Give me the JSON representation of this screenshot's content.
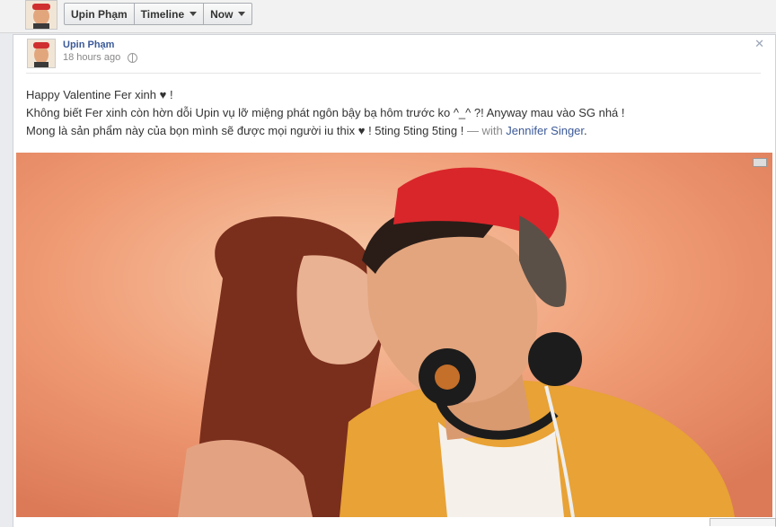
{
  "topbar": {
    "profile_label": "Upin Phạm",
    "timeline_label": "Timeline",
    "now_label": "Now"
  },
  "post": {
    "author": "Upin Phạm",
    "time": "18 hours ago",
    "message_line1": "Happy Valentine Fer xinh ♥ !",
    "message_line2": "Không biết Fer xinh còn hờn dỗi Upin vụ lỡ miệng phát ngôn bậy bạ hôm trước ko ^_^ ?! Anyway mau vào SG nhá !",
    "message_line3": "Mong là sản phẩm này của bọn mình sẽ được mọi người iu thix ♥ ! 5ting 5ting 5ting !",
    "with_text": " — with ",
    "tagged_name": "Jennifer Singer",
    "tag_suffix": "."
  },
  "icons": {
    "close": "close-icon",
    "privacy": "globe-icon",
    "dropdown": "chevron-down-icon"
  },
  "colors": {
    "link": "#3b5998",
    "photo_background": "#ef9f78",
    "cap": "#d9262a",
    "jacket": "#e9a030"
  }
}
